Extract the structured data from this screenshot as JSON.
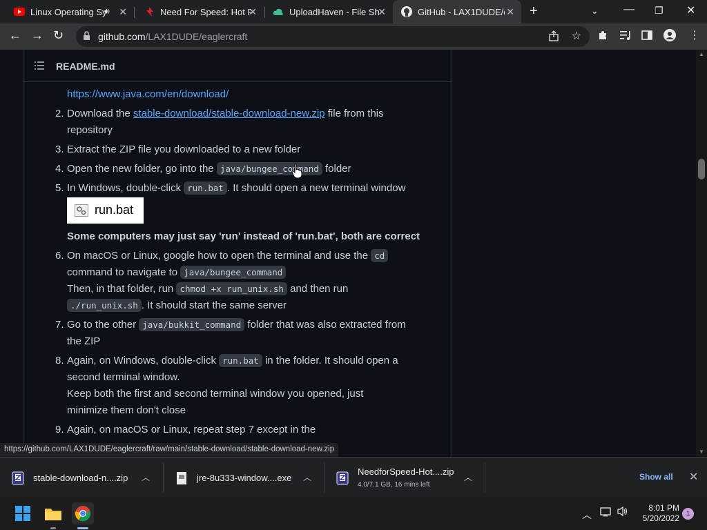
{
  "browser": {
    "tabs": [
      {
        "title": "Linux Operating Sy",
        "icon": "youtube-icon"
      },
      {
        "title": "Need For Speed: Hot P",
        "icon": "nfs-icon"
      },
      {
        "title": "UploadHaven - File Sha",
        "icon": "cloud-icon"
      },
      {
        "title": "GitHub - LAX1DUDE/e",
        "icon": "github-icon"
      }
    ],
    "url_host": "github.com",
    "url_path": "/LAX1DUDE/eaglercraft"
  },
  "readme": {
    "filename": "README.md",
    "java_link": "https://www.java.com/en/download/",
    "steps": {
      "s2_num": "2.",
      "s2_a": "Download the ",
      "s2_link": "stable-download/stable-download-new.zip",
      "s2_b": " file from this",
      "s2_c": "repository",
      "s3_num": "3.",
      "s3": "Extract the ZIP file you downloaded to a new folder",
      "s4_num": "4.",
      "s4_a": "Open the new folder, go into the ",
      "s4_code": "java/bungee_command",
      "s4_b": " folder",
      "s5_num": "5.",
      "s5_a": "In Windows, double-click ",
      "s5_code": "run.bat",
      "s5_b": ". It should open a new terminal window",
      "runbat_label": "run.bat",
      "note": "Some computers may just say 'run' instead of 'run.bat', both are correct",
      "s6_num": "6.",
      "s6_a": "On macOS or Linux, google how to open the terminal and use the ",
      "s6_code1": "cd",
      "s6_b": "command to navigate to ",
      "s6_code2": "java/bungee_command",
      "s6_c": "Then, in that folder, run ",
      "s6_code3": "chmod +x run_unix.sh",
      "s6_d": " and then run",
      "s6_code4": "./run_unix.sh",
      "s6_e": ". It should start the same server",
      "s7_num": "7.",
      "s7_a": "Go to the other ",
      "s7_code": "java/bukkit_command",
      "s7_b": " folder that was also extracted from",
      "s7_c": "the ZIP",
      "s8_num": "8.",
      "s8_a": "Again, on Windows, double-click ",
      "s8_code": "run.bat",
      "s8_b": " in the folder. It should open a",
      "s8_c": "second terminal window.",
      "s8_d": "Keep both the first and second terminal window you opened, just",
      "s8_e": "minimize them don't close",
      "s9_num": "9.",
      "s9_a": "Again, on macOS or Linux, repeat step 7 except in the"
    }
  },
  "status_url": "https://github.com/LAX1DUDE/eaglercraft/raw/main/stable-download/stable-download-new.zip",
  "downloads": {
    "items": [
      {
        "name": "stable-download-n....zip"
      },
      {
        "name": "jre-8u333-window....exe"
      },
      {
        "name": "NeedforSpeed-Hot....zip",
        "sub": "4.0/7.1 GB, 16 mins left"
      }
    ],
    "show_all": "Show all"
  },
  "taskbar": {
    "time": "8:01 PM",
    "date": "5/20/2022",
    "notifications": "1"
  },
  "colors": {
    "link": "#58a6ff",
    "background": "#0d1117",
    "text": "#c9d1d9"
  }
}
